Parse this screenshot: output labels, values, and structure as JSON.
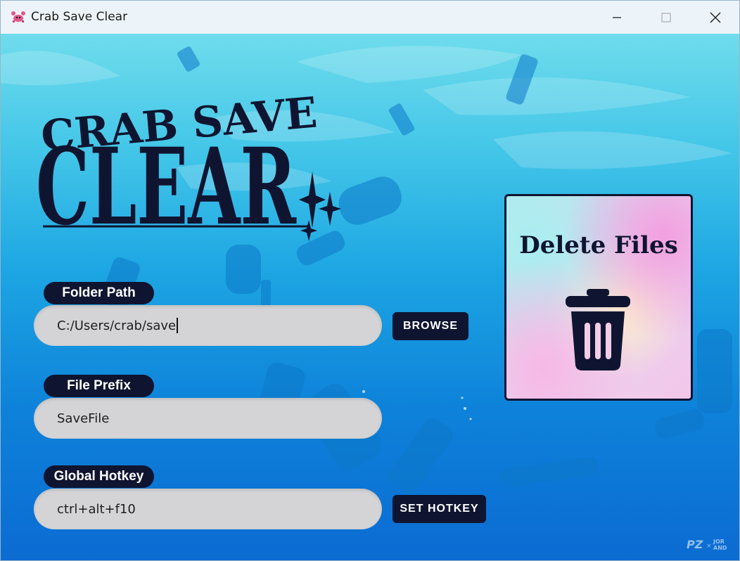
{
  "window": {
    "title": "Crab Save Clear",
    "app_icon": "crab-icon",
    "controls": [
      "minimize-icon",
      "maximize-icon",
      "close-icon"
    ]
  },
  "logo": {
    "line1": "CRAB SAVE",
    "line2": "CLEAR"
  },
  "folder": {
    "label": "Folder Path",
    "value": "C:/Users/crab/save",
    "button": "BROWSE"
  },
  "prefix": {
    "label": "File Prefix",
    "value": "SaveFile"
  },
  "hotkey": {
    "label": "Global Hotkey",
    "value": "ctrl+alt+f10",
    "button": "SET HOTKEY"
  },
  "delete": {
    "title": "Delete Files",
    "icon": "trash-icon"
  },
  "watermark": {
    "left": "PZ",
    "sep": "×",
    "right_top": "JOR",
    "right_bottom": "AND"
  },
  "colors": {
    "navy": "#0f1530",
    "field_bg": "#d4d4d6",
    "sky_top": "#6fdcec",
    "deep_blue": "#0b6bd2"
  }
}
